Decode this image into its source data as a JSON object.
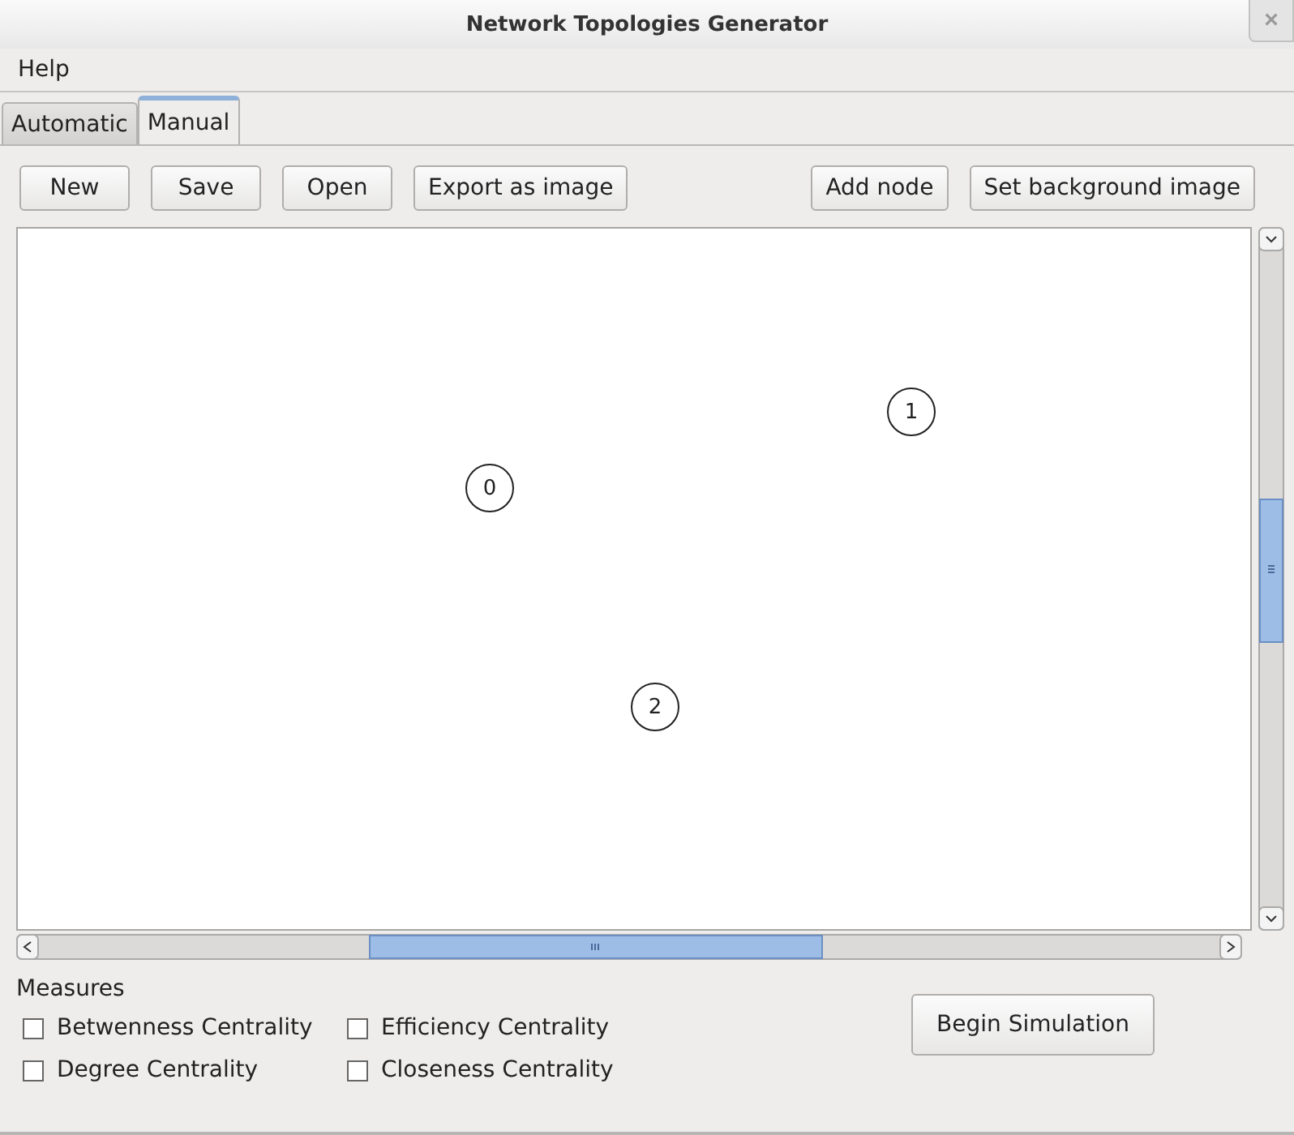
{
  "window": {
    "title": "Network Topologies Generator",
    "close": "×"
  },
  "menu": [
    "Help"
  ],
  "tabs": [
    {
      "label": "Automatic",
      "selected": false
    },
    {
      "label": "Manual",
      "selected": true
    }
  ],
  "toolbar_left": [
    "New",
    "Save",
    "Open",
    "Export as image"
  ],
  "toolbar_right": [
    "Add node",
    "Set background image"
  ],
  "nodes": [
    "0",
    "1",
    "2"
  ],
  "measures": {
    "title": "Measures",
    "options": [
      {
        "label": "Betwenness Centrality",
        "checked": false
      },
      {
        "label": "Efficiency Centrality",
        "checked": false
      },
      {
        "label": "Degree Centrality",
        "checked": false
      },
      {
        "label": "Closeness Centrality",
        "checked": false
      }
    ]
  },
  "simulate_button": "Begin Simulation"
}
